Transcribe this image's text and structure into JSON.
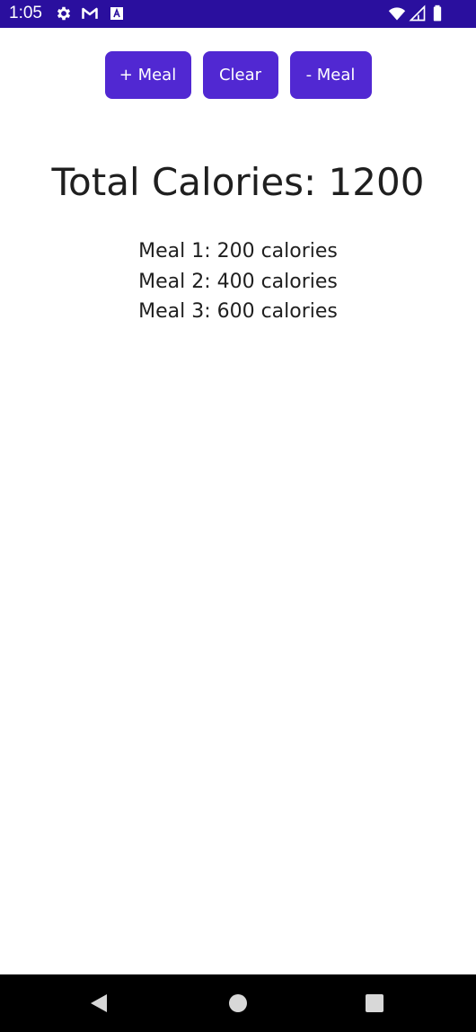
{
  "status_bar": {
    "time": "1:05",
    "icons": [
      "gear-icon",
      "gmail-icon",
      "a-badge-icon",
      "wifi-icon",
      "signal-icon",
      "battery-icon"
    ],
    "background": "#2a0f9e"
  },
  "actions": {
    "add_meal_label": "+ Meal",
    "clear_label": "Clear",
    "remove_meal_label": "- Meal",
    "button_color": "#5128d2"
  },
  "summary": {
    "total_text": "Total Calories: 1200"
  },
  "meals": [
    {
      "text": "Meal 1: 200 calories"
    },
    {
      "text": "Meal 2: 400 calories"
    },
    {
      "text": "Meal 3: 600 calories"
    }
  ],
  "navigation": {
    "buttons": [
      "back-icon",
      "home-icon",
      "recents-icon"
    ]
  }
}
